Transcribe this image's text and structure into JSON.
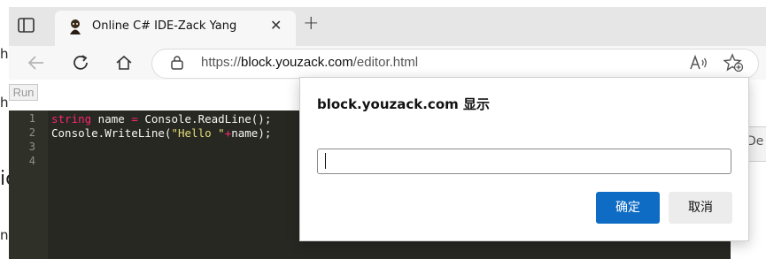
{
  "browser": {
    "tab_title": "Online C# IDE-Zack Yang",
    "close_glyph": "✕",
    "new_tab_glyph": "+",
    "url_scheme": "https://",
    "url_host": "block.youzack.com",
    "url_path": "/editor.html"
  },
  "page": {
    "run_label": "Run",
    "right_fragment": "De",
    "left_fragments": [
      "h",
      "h",
      "ic",
      "n"
    ],
    "code_lines": [
      {
        "num": "1",
        "parts": [
          {
            "t": "string",
            "c": "kw"
          },
          {
            "t": " name ",
            "c": ""
          },
          {
            "t": "=",
            "c": "kw"
          },
          {
            "t": " Console.ReadLine();",
            "c": ""
          }
        ]
      },
      {
        "num": "2",
        "parts": [
          {
            "t": "Console.WriteLine(",
            "c": ""
          },
          {
            "t": "\"Hello \"",
            "c": "str"
          },
          {
            "t": "+",
            "c": "kw"
          },
          {
            "t": "name);",
            "c": ""
          }
        ]
      },
      {
        "num": "3",
        "parts": []
      },
      {
        "num": "4",
        "parts": []
      }
    ]
  },
  "dialog": {
    "title": "block.youzack.com 显示",
    "input_value": "",
    "ok_label": "确定",
    "cancel_label": "取消"
  },
  "colors": {
    "accent": "#0f6cc4",
    "editor_bg": "#272822",
    "keyword": "#f92672",
    "string": "#e6db74"
  }
}
